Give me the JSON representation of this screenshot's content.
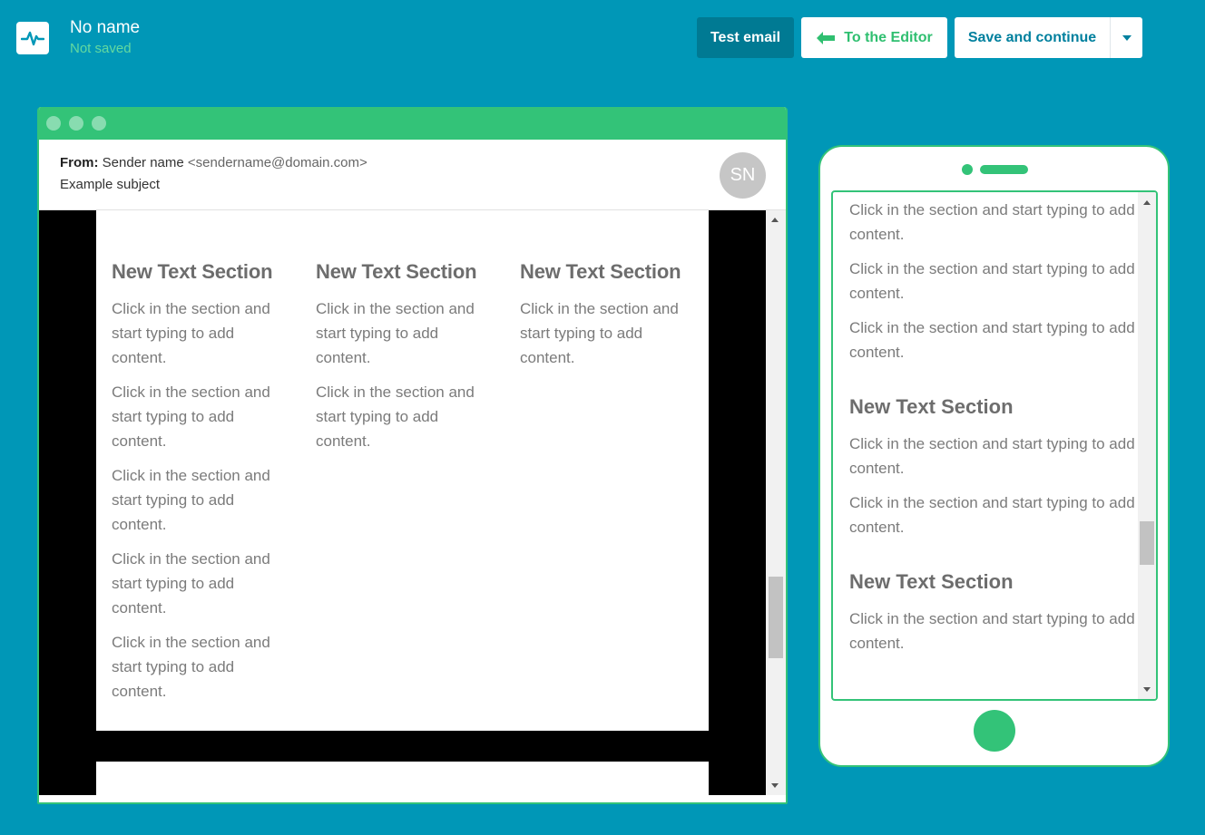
{
  "header": {
    "logo_icon": "pulse-icon",
    "title": "No name",
    "status": "Not saved",
    "test_email_label": "Test email",
    "to_editor_label": "To the Editor",
    "save_continue_label": "Save and continue"
  },
  "desktop": {
    "from_label": "From:",
    "sender_name": "Sender name",
    "sender_address": "<sendername@domain.com>",
    "subject": "Example subject",
    "avatar_initials": "SN",
    "columns": [
      {
        "heading": "New Text Section",
        "paragraphs": [
          "Click in the section and start typing to add content.",
          "Click in the section and start typing to add content.",
          "Click in the section and start typing to add content.",
          "Click in the section and start typing to add content.",
          "Click in the section and start typing to add content."
        ]
      },
      {
        "heading": "New Text Section",
        "paragraphs": [
          "Click in the section and start typing to add content.",
          "Click in the section and start typing to add content."
        ]
      },
      {
        "heading": "New Text Section",
        "paragraphs": [
          "Click in the section and start typing to add content."
        ]
      }
    ]
  },
  "mobile": {
    "blocks": [
      {
        "type": "p",
        "text": "Click in the section and start typing to add content."
      },
      {
        "type": "p",
        "text": "Click in the section and start typing to add content."
      },
      {
        "type": "p",
        "text": "Click in the section and start typing to add content."
      },
      {
        "type": "h",
        "text": "New Text Section"
      },
      {
        "type": "p",
        "text": "Click in the section and start typing to add content."
      },
      {
        "type": "p",
        "text": "Click in the section and start typing to add content."
      },
      {
        "type": "h",
        "text": "New Text Section"
      },
      {
        "type": "p",
        "text": "Click in the section and start typing to add content."
      }
    ]
  },
  "colors": {
    "background": "#0097b7",
    "accent_green": "#33c378",
    "dark_teal": "#007a93"
  }
}
